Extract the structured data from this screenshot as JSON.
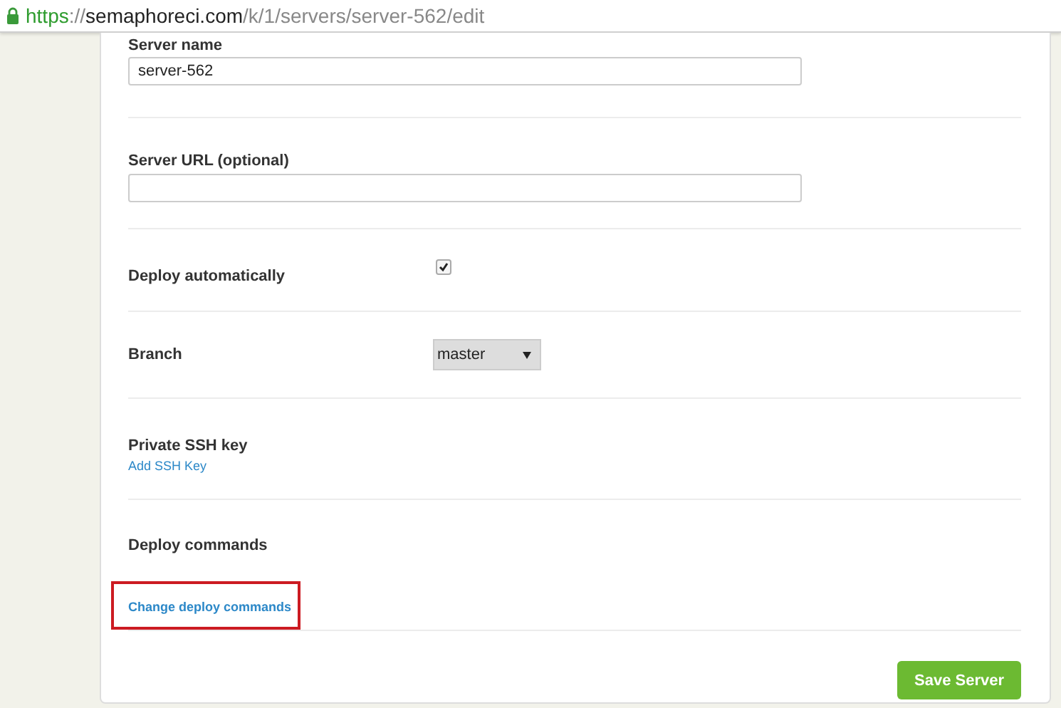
{
  "address_bar": {
    "scheme": "https",
    "separator": "://",
    "host": "semaphoreci.com",
    "path": "/k/1/servers/server-562/edit"
  },
  "form": {
    "fields": [
      {
        "kind": "text",
        "label": "Server name",
        "value": "server-562"
      },
      {
        "kind": "text",
        "label": "Server URL (optional)"
      },
      {
        "kind": "checkbox",
        "label": "Deploy automatically",
        "checked": true
      },
      {
        "kind": "select",
        "label": "Branch",
        "value": "master"
      },
      {
        "kind": "link",
        "label": "Private SSH key",
        "link": "Add SSH Key",
        "highlighted": false
      },
      {
        "kind": "link",
        "label": "Deploy commands",
        "link": "Change deploy commands",
        "highlighted": true
      }
    ],
    "submit": "Save Server"
  }
}
